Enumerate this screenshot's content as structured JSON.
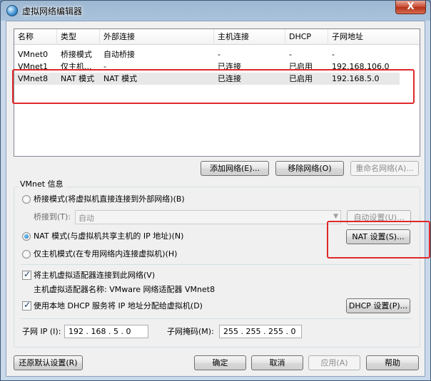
{
  "window": {
    "title": "虚拟网络编辑器",
    "close_glyph": "X"
  },
  "list": {
    "columns": [
      "名称",
      "类型",
      "外部连接",
      "主机连接",
      "DHCP",
      "子网地址"
    ],
    "rows": [
      [
        "VMnet0",
        "桥接模式",
        "自动桥接",
        "-",
        "-",
        "-"
      ],
      [
        "VMnet1",
        "仅主机...",
        "-",
        "已连接",
        "已启用",
        "192.168.106.0"
      ],
      [
        "VMnet8",
        "NAT 模式",
        "NAT 模式",
        "已连接",
        "已启用",
        "192.168.5.0"
      ]
    ]
  },
  "list_buttons": {
    "add": "添加网络(E)...",
    "remove": "移除网络(O)",
    "rename": "重命名网络(A)..."
  },
  "vmnet_info": {
    "group_title": "VMnet 信息",
    "bridge_label": "桥接模式(将虚拟机直接连接到外部网络)(B)",
    "bridge_to_label": "桥接到(T):",
    "bridge_to_value": "自动",
    "auto_settings": "自动设置(U)...",
    "nat_label": "NAT 模式(与虚拟机共享主机的 IP 地址)(N)",
    "nat_settings": "NAT 设置(S)...",
    "hostonly_label": "仅主机模式(在专用网络内连接虚拟机)(H)",
    "connect_adapter_label": "将主机虚拟适配器连接到此网络(V)",
    "adapter_name_label": "主机虚拟适配器名称: VMware 网络适配器 VMnet8",
    "dhcp_label": "使用本地 DHCP 服务将 IP 地址分配给虚拟机(D)",
    "dhcp_settings": "DHCP 设置(P)...",
    "subnet_ip_label": "子网 IP (I):",
    "subnet_ip_value": "192 . 168 .  5  .  0",
    "subnet_mask_label": "子网掩码(M):",
    "subnet_mask_value": "255 . 255 . 255 .  0"
  },
  "bottom_buttons": {
    "restore": "还原默认设置(R)",
    "ok": "确定",
    "cancel": "取消",
    "apply": "应用(A)",
    "help": "帮助"
  },
  "colors": {
    "highlight_box": "#e02828"
  }
}
